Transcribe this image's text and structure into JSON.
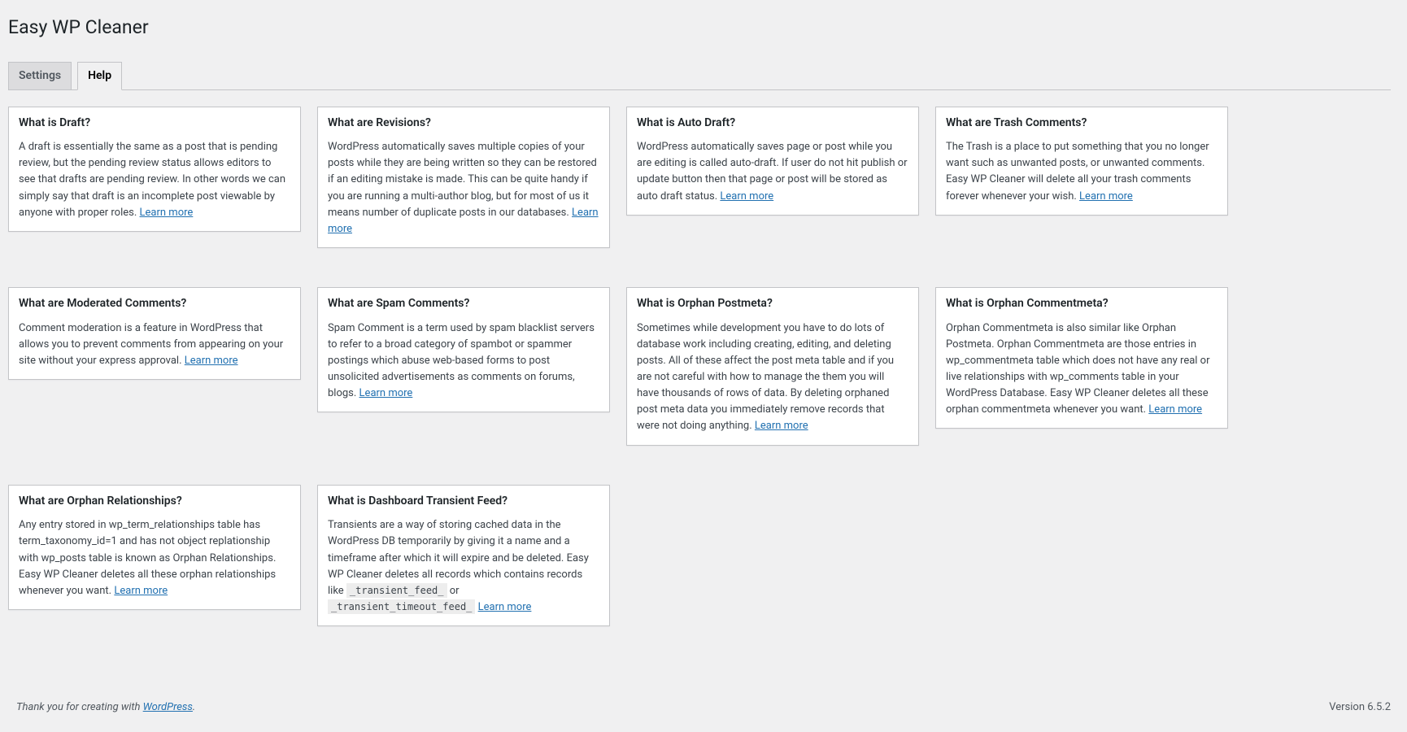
{
  "page_title": "Easy WP Cleaner",
  "tabs": {
    "settings": "Settings",
    "help": "Help"
  },
  "learn_more_label": "Learn more",
  "row1": [
    {
      "title": "What is Draft?",
      "body": "A draft is essentially the same as a post that is pending review, but the pending review status allows editors to see that drafts are pending review. In other words we can simply say that draft is an incomplete post viewable by anyone with proper roles."
    },
    {
      "title": "What are Revisions?",
      "body": "WordPress automatically saves multiple copies of your posts while they are being written so they can be restored if an editing mistake is made. This can be quite handy if you are running a multi-author blog, but for most of us it means number of duplicate posts in our databases."
    },
    {
      "title": "What is Auto Draft?",
      "body": "WordPress automatically saves page or post while you are editing is called auto-draft. If user do not hit publish or update button then that page or post will be stored as auto draft status."
    },
    {
      "title": "What are Trash Comments?",
      "body": "The Trash is a place to put something that you no longer want such as unwanted posts, or unwanted comments. Easy WP Cleaner will delete all your trash comments forever whenever your wish."
    }
  ],
  "row2": [
    {
      "title": "What are Moderated Comments?",
      "body": "Comment moderation is a feature in WordPress that allows you to prevent comments from appearing on your site without your express approval."
    },
    {
      "title": "What are Spam Comments?",
      "body": "Spam Comment is a term used by spam blacklist servers to refer to a broad category of spambot or spammer postings which abuse web-based forms to post unsolicited advertisements as comments on forums, blogs."
    },
    {
      "title": "What is Orphan Postmeta?",
      "body": "Sometimes while development you have to do lots of database work including creating, editing, and deleting posts. All of these affect the post meta table and if you are not careful with how to manage the them you will have thousands of rows of data. By deleting orphaned post meta data you immediately remove records that were not doing anything."
    },
    {
      "title": "What is Orphan Commentmeta?",
      "body": "Orphan Commentmeta is also similar like Orphan Postmeta. Orphan Commentmeta are those entries in wp_commentmeta table which does not have any real or live relationships with wp_comments table in your WordPress Database. Easy WP Cleaner deletes all these orphan commentmeta whenever you want."
    }
  ],
  "row3": [
    {
      "title": "What are Orphan Relationships?",
      "body": "Any entry stored in wp_term_relationships table has term_taxonomy_id=1 and has not object replationship with wp_posts table is known as Orphan Relationships. Easy WP Cleaner deletes all these orphan relationships whenever you want."
    },
    {
      "title": "What is Dashboard Transient Feed?",
      "body_pre": "Transients are a way of storing cached data in the WordPress DB temporarily by giving it a name and a timeframe after which it will expire and be deleted. Easy WP Cleaner deletes all records which contains records like ",
      "code1": "_transient_feed_",
      "mid": " or ",
      "code2": "_transient_timeout_feed_"
    }
  ],
  "footer": {
    "thankyou_pre": "Thank you for creating with ",
    "thankyou_link": "WordPress",
    "thankyou_post": ".",
    "version": "Version 6.5.2"
  }
}
